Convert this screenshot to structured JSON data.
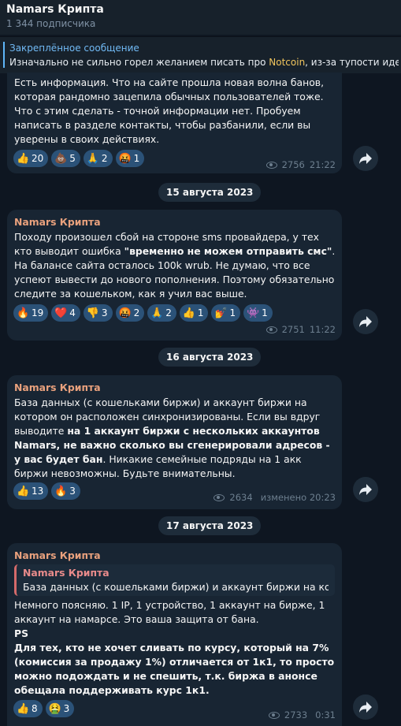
{
  "header": {
    "title": "Namars Крипта",
    "subtitle": "1 344 подписчика"
  },
  "pinned": {
    "label": "Закреплённое сообщение",
    "text_before": "Изначально не сильно горел желанием писать про ",
    "text_highlight": "Notcoin",
    "text_after": ", из-за тупости идеи"
  },
  "messages": [
    {
      "text": "Есть информация. Что на сайте прошла новая волна банов, которая рандомно зацепила обычных пользователей тоже. Что с этим сделать - точной информации нет. Пробуем написать в разделе контакты, чтобы разбанили, если вы уверены в своих действиях.",
      "reactions": [
        {
          "emoji": "👍",
          "count": "20"
        },
        {
          "emoji": "💩",
          "count": "5"
        },
        {
          "emoji": "🙏",
          "count": "2"
        },
        {
          "emoji": "🤬",
          "count": "1"
        }
      ],
      "views": "2756",
      "time": "21:22"
    },
    {
      "date": "15 августа 2023",
      "author": "Namars Крипта",
      "text_1": "Походу произошел сбой на стороне sms провайдера, у тех кто выводит ошибка ",
      "text_bold": "\"временно не можем отправить смс\"",
      "text_2": ". На балансе сайта осталось 100k wrub. Не думаю, что все успеют вывести до нового пополнения. Поэтому обязательно следите за кошельком, как я учил вас выше.",
      "reactions": [
        {
          "emoji": "🔥",
          "count": "19"
        },
        {
          "emoji": "❤️",
          "count": "4"
        },
        {
          "emoji": "👎",
          "count": "3"
        },
        {
          "emoji": "🤬",
          "count": "2"
        },
        {
          "emoji": "🙏",
          "count": "2"
        },
        {
          "emoji": "👍",
          "count": "1"
        },
        {
          "emoji": "💅",
          "count": "1"
        },
        {
          "emoji": "👾",
          "count": "1"
        }
      ],
      "views": "2751",
      "time": "11:22"
    },
    {
      "date": "16 августа 2023",
      "author": "Namars Крипта",
      "text_1": "База данных (с кошельками биржи) и аккаунт биржи на котором он расположен синхронизированы. Если вы вдруг выводите ",
      "text_bold": "на 1 аккаунт биржи с нескольких аккаунтов Namars, не важно сколько вы сгенерировали адресов - у вас будет бан",
      "text_2": ". Никакие семейные подряды на 1 акк биржи невозможны. Будьте внимательны.",
      "reactions": [
        {
          "emoji": "👍",
          "count": "13"
        },
        {
          "emoji": "🔥",
          "count": "3"
        }
      ],
      "views": "2634",
      "time": "изменено 20:23"
    },
    {
      "date": "17 августа 2023",
      "author": "Namars Крипта",
      "quote_author": "Namars Крипта",
      "quote_text": "База данных (с кошельками биржи) и аккаунт биржи на кото...",
      "text_1": "Немного поясняю. 1 IP, 1 устройство, 1 аккаунт на бирже, 1 аккаунт на намарсе. Это ваша защита от бана.",
      "text_ps": "PS",
      "text_bold": "Для тех, кто не хочет сливать по курсу, который на 7% (комиссия за продажу 1%) отличается от 1к1, то просто можно подождать и не спешить, т.к. биржа в анонсе обещала поддерживать курс 1к1.",
      "reactions": [
        {
          "emoji": "👍",
          "count": "8"
        },
        {
          "emoji": "🤮",
          "count": "3"
        }
      ],
      "views": "2733",
      "time": "0:31"
    }
  ],
  "colors": {
    "bg": "#0e1621",
    "bubble": "#182533",
    "accent": "#5eb5f7",
    "author": "#e9a17d",
    "reaction": "#2b5278"
  },
  "icons": {
    "views": "eye-icon",
    "share": "share-arrow-icon"
  }
}
